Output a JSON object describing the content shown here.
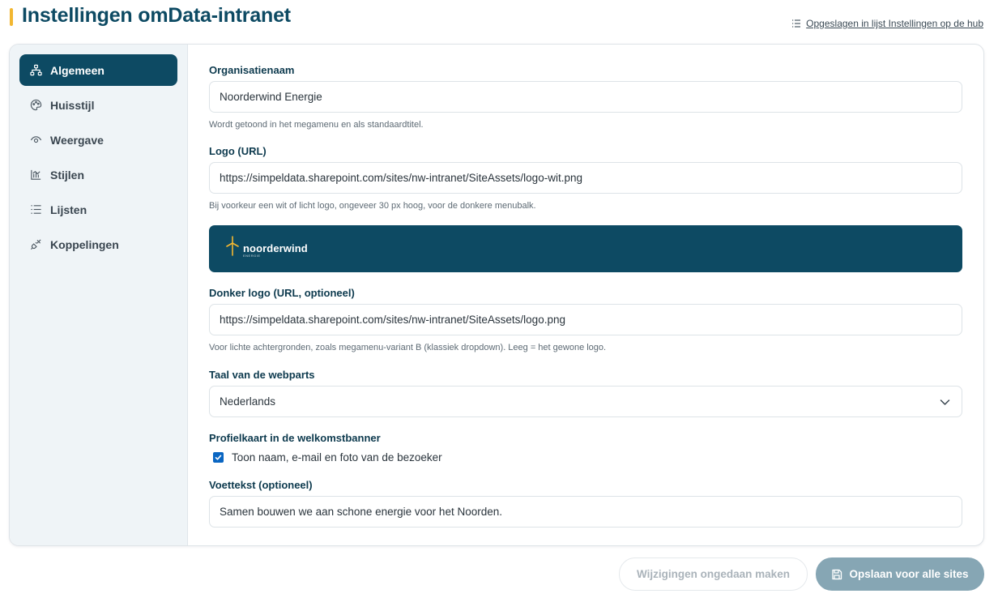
{
  "header": {
    "title": "Instellingen omData-intranet",
    "hub_link": "Opgeslagen in lijst Instellingen op de hub"
  },
  "sidebar": {
    "items": [
      {
        "label": "Algemeen",
        "icon": "sitemap-icon",
        "active": true
      },
      {
        "label": "Huisstijl",
        "icon": "palette-icon",
        "active": false
      },
      {
        "label": "Weergave",
        "icon": "eye-icon",
        "active": false
      },
      {
        "label": "Stijlen",
        "icon": "chart-icon",
        "active": false
      },
      {
        "label": "Lijsten",
        "icon": "list-icon",
        "active": false
      },
      {
        "label": "Koppelingen",
        "icon": "plug-icon",
        "active": false
      }
    ]
  },
  "form": {
    "org_name": {
      "label": "Organisatienaam",
      "value": "Noorderwind Energie",
      "hint": "Wordt getoond in het megamenu en als standaardtitel."
    },
    "logo": {
      "label": "Logo (URL)",
      "value": "https://simpeldata.sharepoint.com/sites/nw-intranet/SiteAssets/logo-wit.png",
      "hint": "Bij voorkeur een wit of licht logo, ongeveer 30 px hoog, voor de donkere menubalk."
    },
    "logo_preview": {
      "wordmark": "noorderwind",
      "subtext": "ENERGIE"
    },
    "dark_logo": {
      "label": "Donker logo (URL, optioneel)",
      "value": "https://simpeldata.sharepoint.com/sites/nw-intranet/SiteAssets/logo.png",
      "hint": "Voor lichte achtergronden, zoals megamenu-variant B (klassiek dropdown). Leeg = het gewone logo."
    },
    "language": {
      "label": "Taal van de webparts",
      "value": "Nederlands"
    },
    "profile_card": {
      "label": "Profielkaart in de welkomstbanner",
      "checkbox_label": "Toon naam, e-mail en foto van de bezoeker",
      "checked": true
    },
    "footer_text": {
      "label": "Voettekst (optioneel)",
      "value": "Samen bouwen we aan schone energie voor het Noorden."
    }
  },
  "actions": {
    "undo_label": "Wijzigingen ongedaan maken",
    "save_label": "Opslaan voor alle sites"
  },
  "colors": {
    "brand": "#0d4a63",
    "accent": "#f2b731",
    "save_disabled": "#86a6b4"
  }
}
